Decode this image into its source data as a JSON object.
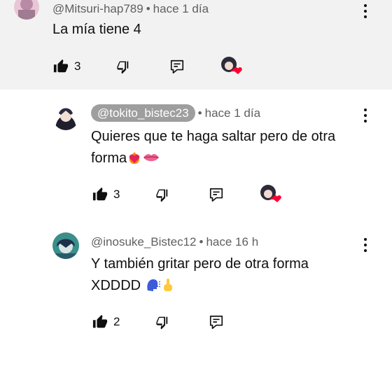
{
  "comments": [
    {
      "handle": "@Mitsuri-hap789",
      "time": "hace 1 día",
      "text": "La mía tiene 4",
      "likes": "3",
      "creator_heart": true
    },
    {
      "handle": "@tokito_bistec23",
      "time": "hace 1 día",
      "text_line1": "Quieres que te haga saltar pero de otra",
      "text_line2": "forma",
      "likes": "3",
      "creator_heart": true
    },
    {
      "handle": "@inosuke_Bistec12",
      "time": "hace 16 h",
      "text_line1": "Y también gritar pero de otra forma",
      "text_line2": "XDDDD",
      "likes": "2",
      "creator_heart": false
    }
  ],
  "separator": "•",
  "colors": {
    "heart": "#ff0033",
    "chip": "#9e9e9e",
    "meta": "#606060",
    "highlight_bg": "#f2f2f2"
  },
  "icons": [
    "like-icon",
    "dislike-icon",
    "reply-icon",
    "more-icon",
    "creator-heart-icon"
  ]
}
